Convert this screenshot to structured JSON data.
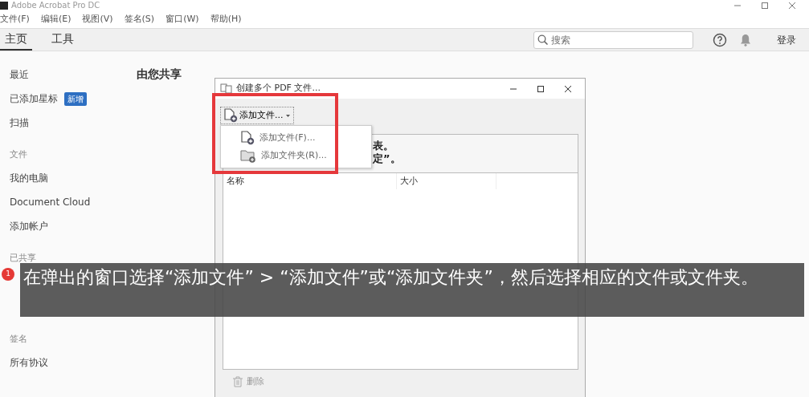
{
  "app": {
    "title": "Adobe Acrobat Pro DC"
  },
  "menu": [
    "文件(F)",
    "编辑(E)",
    "视图(V)",
    "签名(S)",
    "窗口(W)",
    "帮助(H)"
  ],
  "tabs": [
    {
      "label": "主页",
      "selected": true
    },
    {
      "label": "工具",
      "selected": false
    }
  ],
  "search": {
    "placeholder": "搜索"
  },
  "sign_in": "登录",
  "sidebar": {
    "items": [
      {
        "kind": "item",
        "label": "最近"
      },
      {
        "kind": "item",
        "label": "已添加星标",
        "badge": "新增"
      },
      {
        "kind": "item",
        "label": "扫描"
      },
      {
        "kind": "header",
        "label": "文件"
      },
      {
        "kind": "item",
        "label": "我的电脑"
      },
      {
        "kind": "item",
        "label": "Document Cloud"
      },
      {
        "kind": "item",
        "label": "添加帐户"
      },
      {
        "kind": "header",
        "label": "已共享"
      },
      {
        "kind": "gap"
      },
      {
        "kind": "header",
        "label": "签名"
      },
      {
        "kind": "item",
        "label": "所有协议"
      }
    ]
  },
  "heading": "由您共享",
  "dialog": {
    "title": "创建多个 PDF 文件...",
    "add_button": "添加文件...",
    "instructions": [
      "表。",
      "定”。"
    ],
    "menu": [
      {
        "kind": "file",
        "label": "添加文件(F)..."
      },
      {
        "kind": "folder",
        "label": "添加文件夹(R)..."
      }
    ],
    "columns": [
      "名称",
      "大小"
    ],
    "delete_button": "删除"
  },
  "caption": {
    "badge": "1",
    "text": "在弹出的窗口选择“添加文件” > “添加文件”或“添加文件夹”，然后选择相应的文件或文件夹。"
  }
}
